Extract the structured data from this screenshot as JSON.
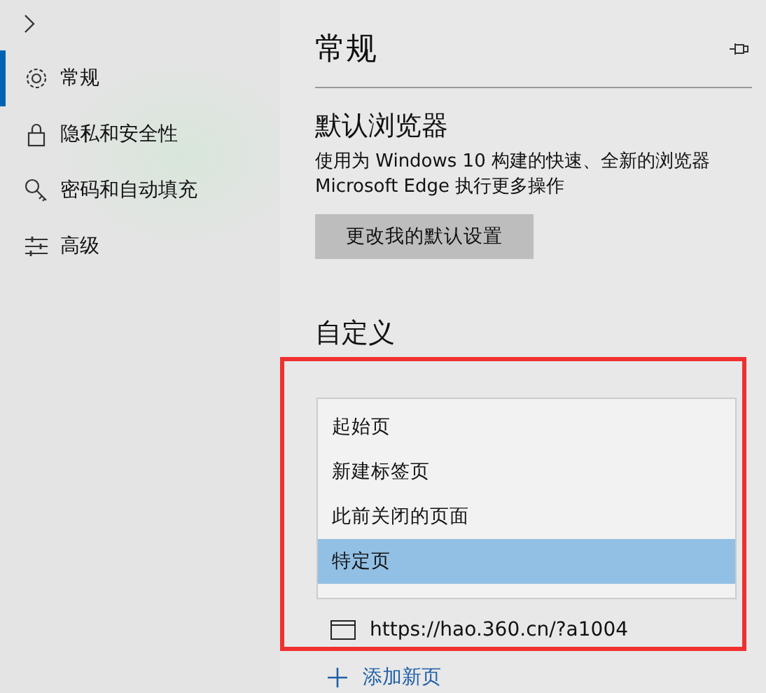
{
  "sidebar": {
    "items": [
      {
        "label": "常规",
        "selected": true
      },
      {
        "label": "隐私和安全性",
        "selected": false
      },
      {
        "label": "密码和自动填充",
        "selected": false
      },
      {
        "label": "高级",
        "selected": false
      }
    ]
  },
  "page": {
    "title": "常规",
    "default_browser": {
      "heading": "默认浏览器",
      "description": "使用为 Windows 10 构建的快速、全新的浏览器 Microsoft Edge 执行更多操作",
      "button": "更改我的默认设置"
    },
    "customize": {
      "heading": "自定义",
      "dropdown": {
        "options": [
          {
            "label": "起始页",
            "selected": false
          },
          {
            "label": "新建标签页",
            "selected": false
          },
          {
            "label": "此前关闭的页面",
            "selected": false
          },
          {
            "label": "特定页",
            "selected": true
          }
        ]
      },
      "pages": [
        "https://hao.360.cn/?a1004"
      ],
      "add_page": "添加新页"
    }
  }
}
